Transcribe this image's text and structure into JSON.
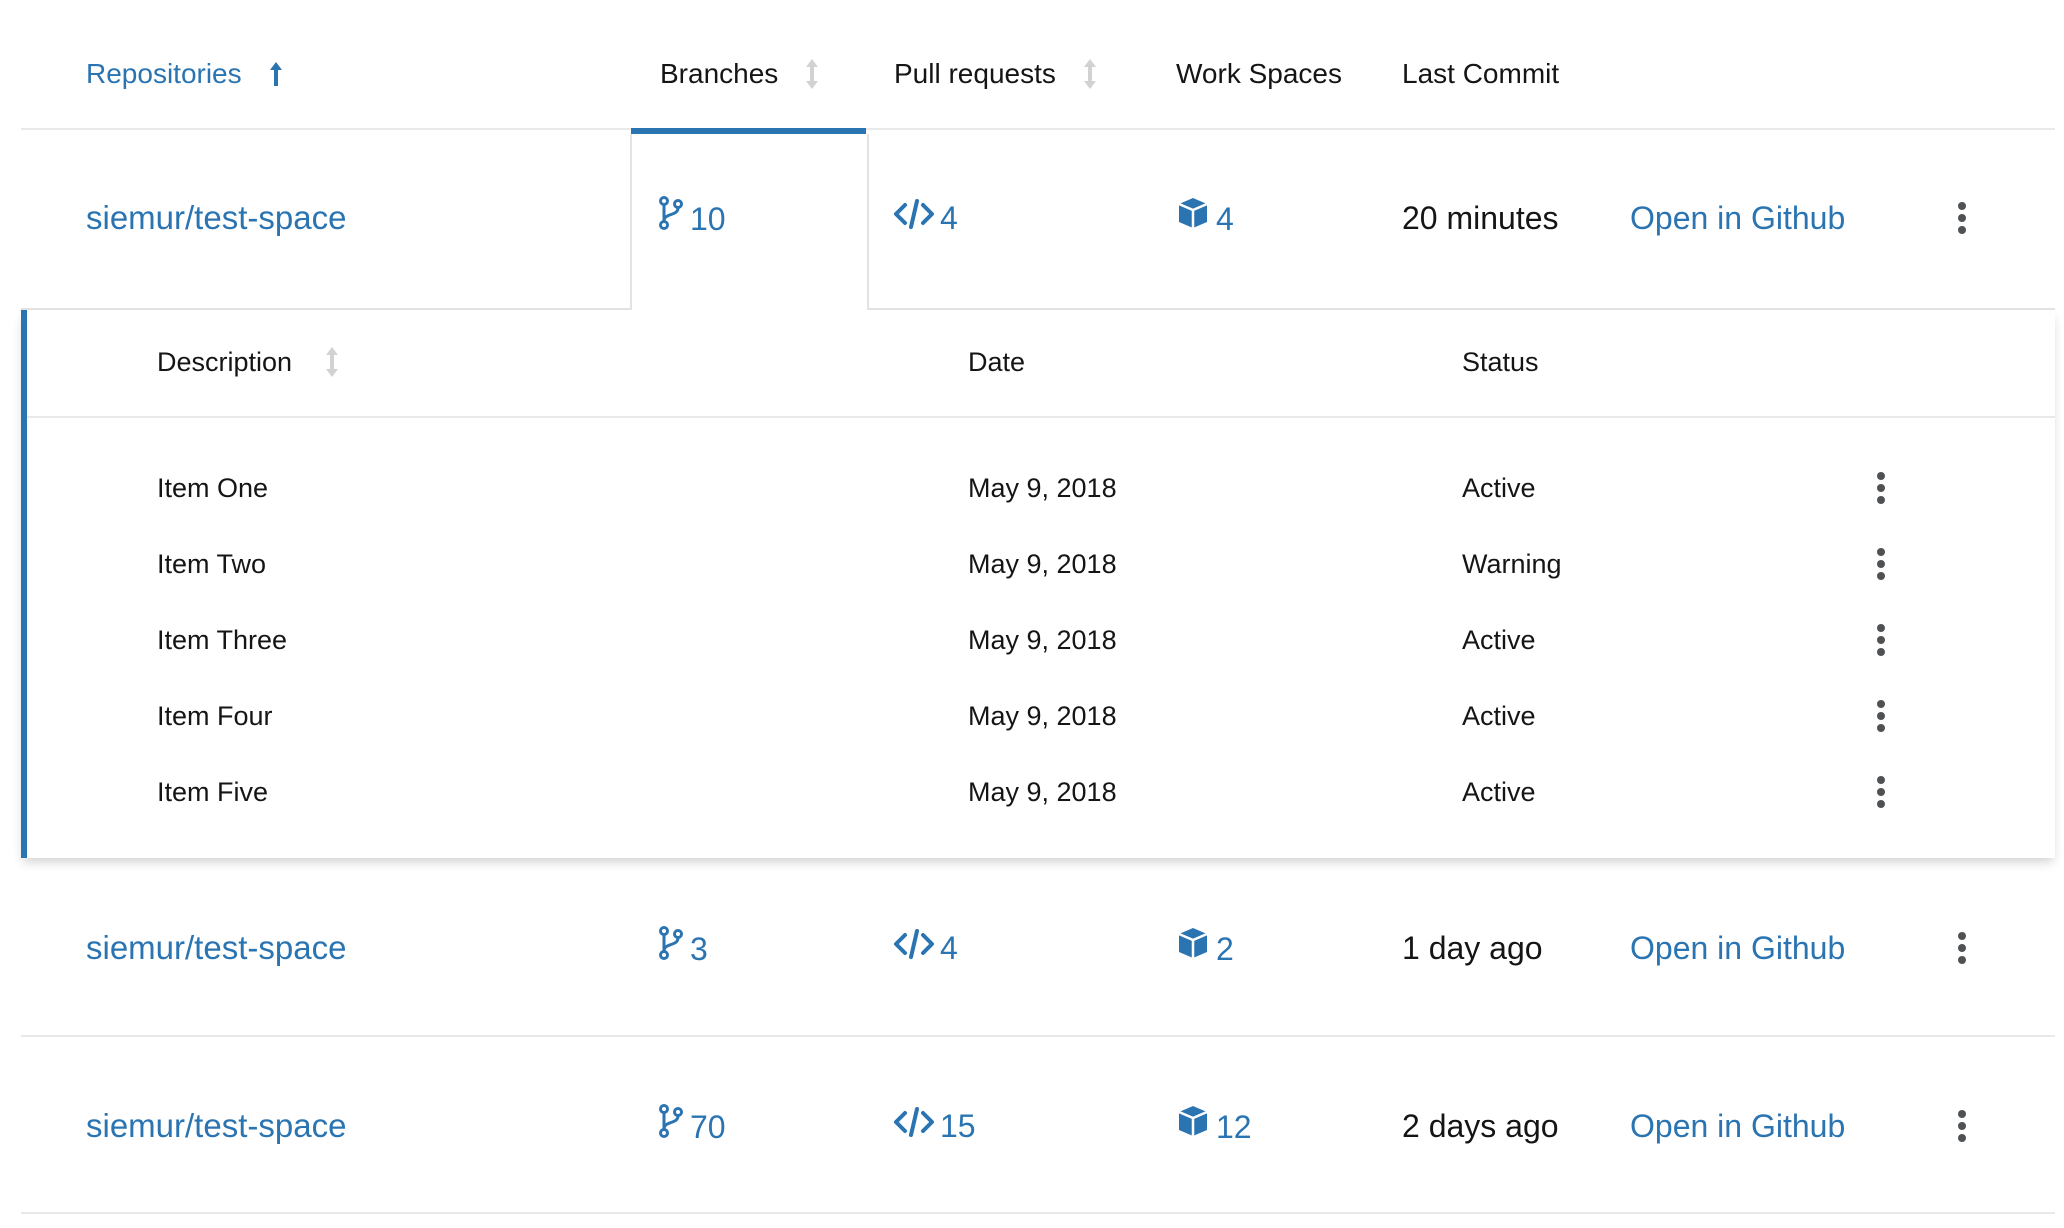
{
  "header": {
    "repositories": "Repositories",
    "branches": "Branches",
    "pull_requests": "Pull requests",
    "work_spaces": "Work Spaces",
    "last_commit": "Last Commit"
  },
  "rows": [
    {
      "name": "siemur/test-space",
      "branches": "10",
      "pull_requests": "4",
      "work_spaces": "4",
      "last_commit": "20 minutes",
      "link": "Open in Github"
    },
    {
      "name": "siemur/test-space",
      "branches": "3",
      "pull_requests": "4",
      "work_spaces": "2",
      "last_commit": "1 day ago",
      "link": "Open in Github"
    },
    {
      "name": "siemur/test-space",
      "branches": "70",
      "pull_requests": "15",
      "work_spaces": "12",
      "last_commit": "2 days ago",
      "link": "Open in Github"
    }
  ],
  "expanded": {
    "headers": {
      "description": "Description",
      "date": "Date",
      "status": "Status"
    },
    "items": [
      {
        "description": "Item One",
        "date": "May 9, 2018",
        "status": "Active"
      },
      {
        "description": "Item Two",
        "date": "May 9, 2018",
        "status": "Warning"
      },
      {
        "description": "Item Three",
        "date": "May 9, 2018",
        "status": "Active"
      },
      {
        "description": "Item Four",
        "date": "May 9, 2018",
        "status": "Active"
      },
      {
        "description": "Item Five",
        "date": "May 9, 2018",
        "status": "Active"
      }
    ]
  },
  "icons": {
    "sort_active": "arrow-up-icon",
    "sort_inactive": "sort-icon",
    "branches": "code-branch-icon",
    "pull_requests": "code-icon",
    "work_spaces": "cube-icon",
    "kebab": "kebab-icon"
  },
  "colors": {
    "accent": "#2b74b2",
    "sort_inactive": "#d2d2d2",
    "divider": "#e9e9e9"
  }
}
